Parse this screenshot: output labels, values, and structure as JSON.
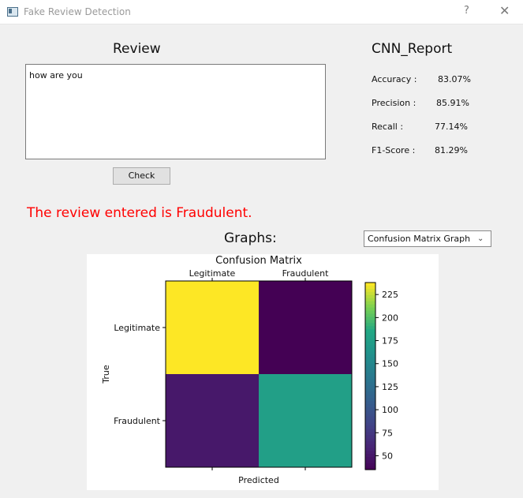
{
  "window": {
    "title": "Fake Review Detection",
    "help": "?",
    "close": "✕"
  },
  "review": {
    "heading": "Review",
    "text": "how are you",
    "check_label": "Check"
  },
  "report": {
    "heading": "CNN_Report",
    "metrics": [
      {
        "label": "Accuracy :",
        "value": "83.07%"
      },
      {
        "label": "Precision :",
        "value": "85.91%"
      },
      {
        "label": "Recall :",
        "value": "77.14%"
      },
      {
        "label": "F1-Score :",
        "value": "81.29%"
      }
    ]
  },
  "result": {
    "message": "The review entered is Fraudulent.",
    "color": "#ff0000"
  },
  "graphs": {
    "label": "Graphs:",
    "selected": "Confusion Matrix Graph"
  },
  "chart_data": {
    "type": "heatmap",
    "title": "Confusion Matrix",
    "xlabel": "Predicted",
    "ylabel": "True",
    "x_tick_labels": [
      "Legitimate",
      "Fraudulent"
    ],
    "y_tick_labels": [
      "Legitimate",
      "Fraudulent"
    ],
    "matrix": [
      [
        238,
        35
      ],
      [
        52,
        177
      ]
    ],
    "colormap": "viridis",
    "colorbar_ticks": [
      50,
      75,
      100,
      125,
      150,
      175,
      200,
      225
    ],
    "colorbar_range": [
      35,
      238
    ]
  }
}
